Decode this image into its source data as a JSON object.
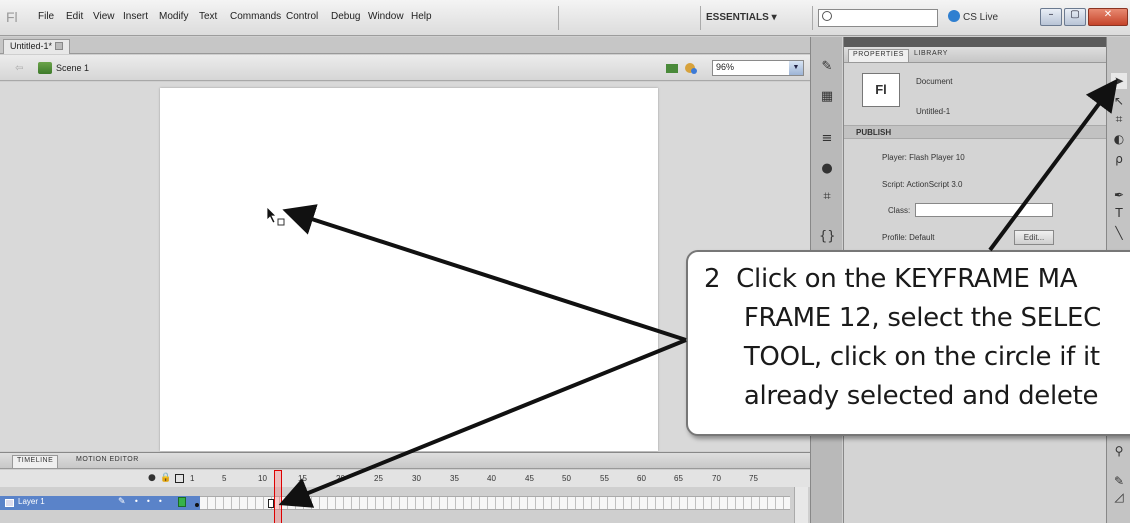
{
  "menubar": {
    "items": [
      "File",
      "Edit",
      "View",
      "Insert",
      "Modify",
      "Text",
      "Commands",
      "Control",
      "Debug",
      "Window",
      "Help"
    ],
    "workspace": "ESSENTIALS ▾",
    "cslive": "CS Live",
    "search_placeholder": ""
  },
  "document": {
    "tab_label": "Untitled-1*",
    "scene_label": "Scene 1",
    "zoom": "96%"
  },
  "timeline": {
    "tabs": [
      "TIMELINE",
      "MOTION EDITOR"
    ],
    "frame_numbers": [
      "1",
      "5",
      "10",
      "15",
      "20",
      "25",
      "30",
      "35",
      "40",
      "45",
      "50",
      "55",
      "60",
      "65",
      "70",
      "75"
    ],
    "layer_name": "Layer 1"
  },
  "properties": {
    "tabs": [
      "PROPERTIES",
      "LIBRARY"
    ],
    "doc_type": "Document",
    "doc_name": "Untitled-1",
    "doc_icon": "Fl",
    "section": "PUBLISH",
    "player": "Player: Flash Player 10",
    "script": "Script: ActionScript 3.0",
    "class_label": "Class:",
    "profile": "Profile: Default",
    "edit_button": "Edit..."
  },
  "callout": {
    "text": "2  Click on the KEYFRAME MA\n     FRAME 12, select the SELEC\n     TOOL, click on the circle if it\n     already selected and delete"
  },
  "colors": {
    "callout_border": "#777777",
    "playhead": "#dd0000",
    "layer_highlight": "#5a83c9",
    "keyframe": "#36b24a"
  }
}
